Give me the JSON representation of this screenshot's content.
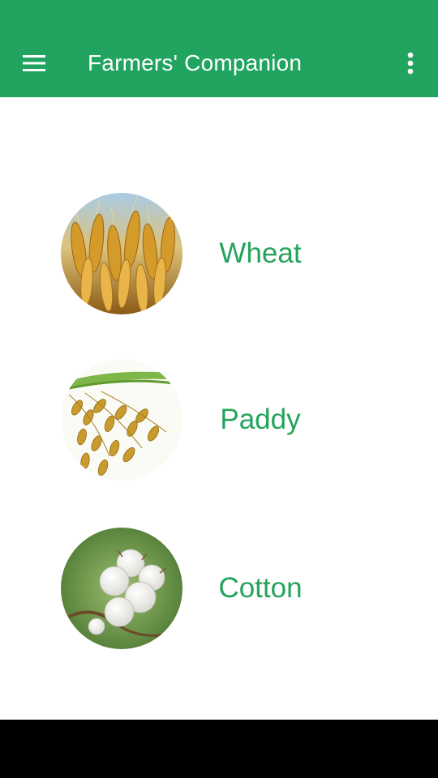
{
  "app_bar": {
    "title": "Farmers' Companion",
    "menu_icon": "hamburger-menu-icon",
    "overflow_icon": "more-vert-icon",
    "background_color": "#21a45f"
  },
  "crops": [
    {
      "label": "Wheat",
      "image": "wheat-image"
    },
    {
      "label": "Paddy",
      "image": "paddy-image"
    },
    {
      "label": "Cotton",
      "image": "cotton-image"
    }
  ],
  "colors": {
    "label": "#23a35b",
    "nav_bar": "#000000"
  }
}
